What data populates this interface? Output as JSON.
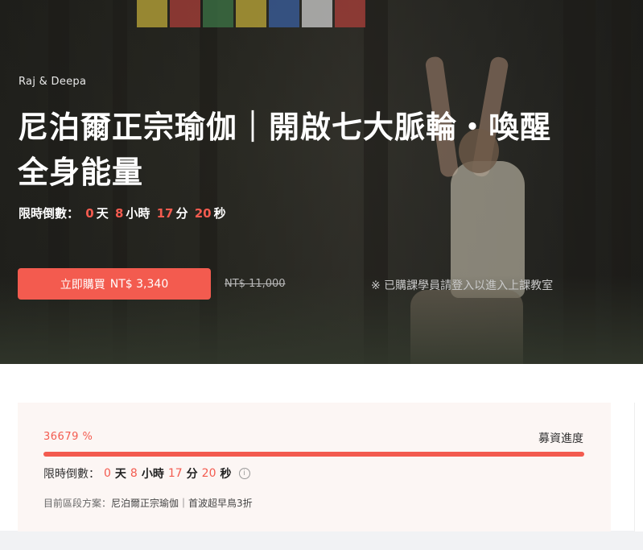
{
  "course": {
    "author": "Raj & Deepa",
    "title": "尼泊爾正宗瑜伽｜開啟七大脈輪・喚醒全身能量"
  },
  "countdown": {
    "label": "限時倒數：",
    "days": "0",
    "days_unit": "天",
    "hours": "8",
    "hours_unit": "小時",
    "minutes": "17",
    "minutes_unit": "分",
    "seconds": "20",
    "seconds_unit": "秒"
  },
  "purchase": {
    "button_label": "立即購買",
    "price": "NT$ 3,340",
    "original_price": "NT$ 11,000",
    "login_notice": "※ 已購課學員請登入以進入上課教室"
  },
  "funding": {
    "percent_text": "36679 %",
    "progress_fraction": 1.0,
    "progress_label": "募資進度",
    "plan_label": "目前區段方案：",
    "plan_name": "尼泊爾正宗瑜伽｜首波超早鳥3折"
  },
  "colors": {
    "accent": "#f35b4f"
  },
  "icons": {
    "info": "info-icon"
  }
}
